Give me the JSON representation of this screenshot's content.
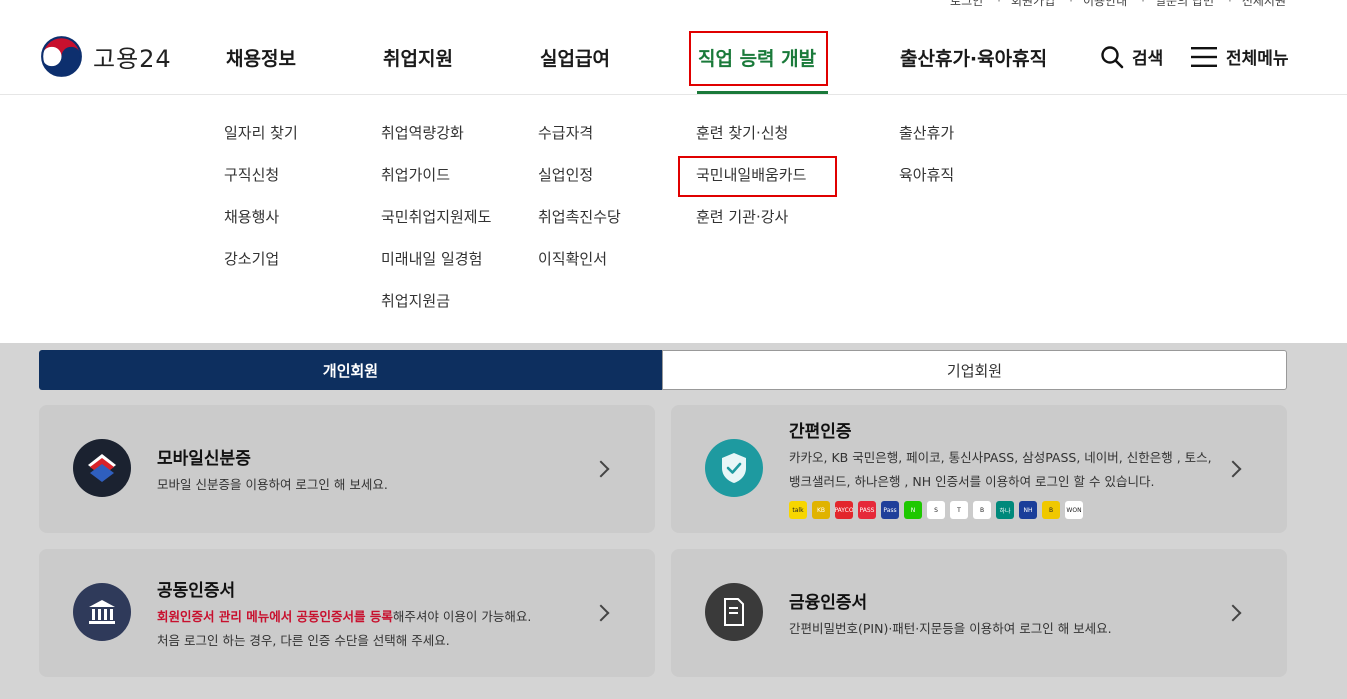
{
  "header": {
    "util_links": [
      "로그인",
      "회원가입",
      "이용안내",
      "일문의 답변",
      "전체지원"
    ],
    "logo_text": "고용24",
    "nav": [
      {
        "label": "채용정보"
      },
      {
        "label": "취업지원"
      },
      {
        "label": "실업급여"
      },
      {
        "label": "직업 능력 개발"
      },
      {
        "label": "출산휴가·육아휴직"
      }
    ],
    "search_label": "검색",
    "menu_label": "전체메뉴"
  },
  "mega_menu": {
    "col1": [
      "일자리 찾기",
      "구직신청",
      "채용행사",
      "강소기업"
    ],
    "col2": [
      "취업역량강화",
      "취업가이드",
      "국민취업지원제도",
      "미래내일 일경험",
      "취업지원금"
    ],
    "col3": [
      "수급자격",
      "실업인정",
      "취업촉진수당",
      "이직확인서"
    ],
    "col4": [
      "훈련 찾기·신청",
      "국민내일배움카드",
      "훈련 기관·강사"
    ],
    "col5": [
      "출산휴가",
      "육아휴직"
    ]
  },
  "tabs": {
    "personal": "개인회원",
    "corporate": "기업회원"
  },
  "cards": {
    "mobile_id": {
      "title": "모바일신분증",
      "desc": "모바일 신분증을 이용하여 로그인 해 보세요."
    },
    "simple_auth": {
      "title": "간편인증",
      "desc1": "카카오, KB 국민은행, 페이코, 통신사PASS, 삼성PASS, 네이버, 신한은행 , 토스,",
      "desc2": "뱅크샐러드, 하나은행 , NH 인증서를 이용하여 로그인 할 수 있습니다."
    },
    "joint_cert": {
      "title": "공동인증서",
      "desc_em": "회원인증서 관리 메뉴에서 공동인증서를 등록",
      "desc_rest": "해주셔야 이용이 가능해요.",
      "desc2": "처음 로그인 하는 경우, 다른 인증 수단을 선택해 주세요."
    },
    "finance_cert": {
      "title": "금융인증서",
      "desc": "간편비밀번호(PIN)·패턴·지문등을 이용하여 로그인 해 보세요."
    }
  },
  "provider_icons": [
    {
      "name": "kakao-icon",
      "color": "#f7d600",
      "text": "talk"
    },
    {
      "name": "kb-icon",
      "color": "#e0b300",
      "text": "KB"
    },
    {
      "name": "payco-icon",
      "color": "#e3262c",
      "text": "PAYCO"
    },
    {
      "name": "pass-icon",
      "color": "#e6283a",
      "text": "PASS"
    },
    {
      "name": "samsung-pass-icon",
      "color": "#1f3f9a",
      "text": "Pass"
    },
    {
      "name": "naver-icon",
      "color": "#1ec800",
      "text": "N"
    },
    {
      "name": "shinhan-icon",
      "color": "#ffffff",
      "text": "S"
    },
    {
      "name": "toss-icon",
      "color": "#ffffff",
      "text": "T"
    },
    {
      "name": "banksalad-icon",
      "color": "#ffffff",
      "text": "B"
    },
    {
      "name": "hana-icon",
      "color": "#00897b",
      "text": "하나"
    },
    {
      "name": "nh-icon",
      "color": "#1a3e9a",
      "text": "NH"
    },
    {
      "name": "b-icon",
      "color": "#f0c800",
      "text": "B"
    },
    {
      "name": "woori-icon",
      "color": "#ffffff",
      "text": "WON"
    }
  ]
}
